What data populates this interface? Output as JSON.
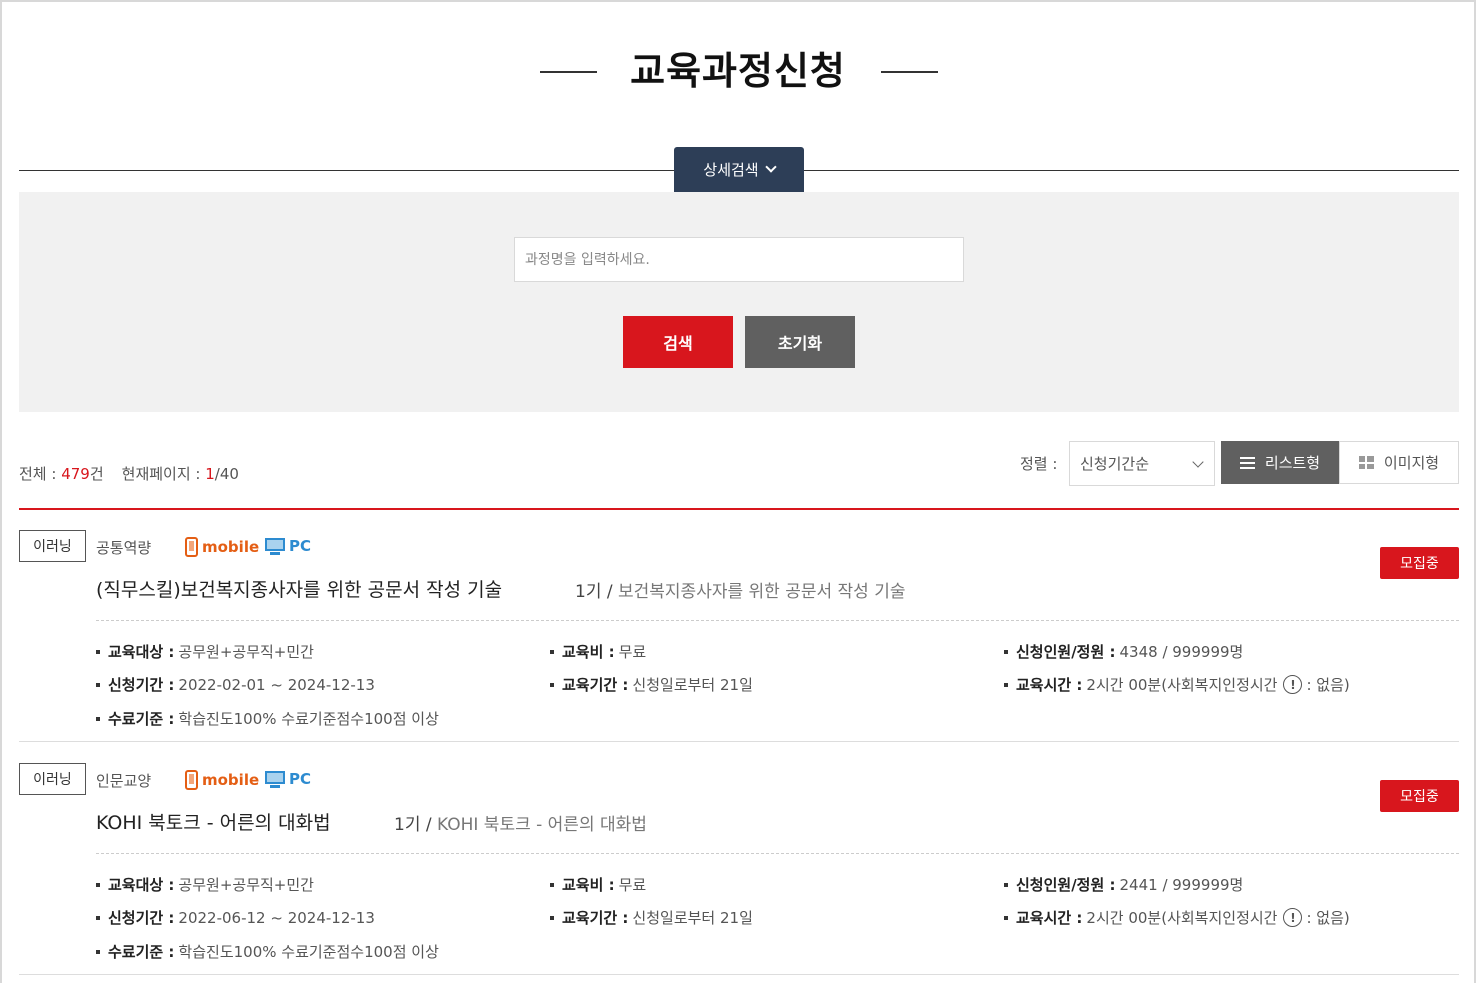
{
  "header": {
    "title": "교육과정신청"
  },
  "search": {
    "detail_label": "상세검색",
    "placeholder": "과정명을 입력하세요.",
    "search_label": "검색",
    "reset_label": "초기화"
  },
  "summary": {
    "total_label": "전체 : ",
    "total_count": "479",
    "total_unit": "건",
    "page_label": "현재페이지 : ",
    "current_page": "1",
    "total_pages": "/40"
  },
  "sort": {
    "label": "정렬 :",
    "selected": "신청기간순",
    "view_list": "리스트형",
    "view_image": "이미지형"
  },
  "courses": [
    {
      "type": "이러닝",
      "category": "공통역량",
      "device_mobile": "mobile",
      "device_pc": "PC",
      "status": "모집중",
      "title": "(직무스킬)보건복지종사자를 위한 공문서 작성 기술",
      "cycle": "1기 / ",
      "cycle_sub": "보건복지종사자를 위한 공문서 작성 기술",
      "target_k": "교육대상 :",
      "target_v": "공무원+공무직+민간",
      "fee_k": "교육비 :",
      "fee_v": "무료",
      "applicants_k": "신청인원/정원 :",
      "applicants_v": "4348 / 999999명",
      "apply_period_k": "신청기간 :",
      "apply_period_v": "2022-02-01 ~ 2024-12-13",
      "edu_period_k": "교육기간 :",
      "edu_period_v": "신청일로부터 21일",
      "edu_time_k": "교육시간 :",
      "edu_time_v": "2시간 00분(사회복지인정시간",
      "edu_time_v2": ": 없음)",
      "complete_k": "수료기준 :",
      "complete_v": "학습진도100% 수료기준점수100점 이상"
    },
    {
      "type": "이러닝",
      "category": "인문교양",
      "device_mobile": "mobile",
      "device_pc": "PC",
      "status": "모집중",
      "title": "KOHI 북토크 - 어른의 대화법",
      "cycle": "1기 / ",
      "cycle_sub": "KOHI 북토크 - 어른의 대화법",
      "target_k": "교육대상 :",
      "target_v": "공무원+공무직+민간",
      "fee_k": "교육비 :",
      "fee_v": "무료",
      "applicants_k": "신청인원/정원 :",
      "applicants_v": "2441 / 999999명",
      "apply_period_k": "신청기간 :",
      "apply_period_v": "2022-06-12 ~ 2024-12-13",
      "edu_period_k": "교육기간 :",
      "edu_period_v": "신청일로부터 21일",
      "edu_time_k": "교육시간 :",
      "edu_time_v": "2시간 00분(사회복지인정시간",
      "edu_time_v2": ": 없음)",
      "complete_k": "수료기준 :",
      "complete_v": "학습진도100% 수료기준점수100점 이상"
    }
  ],
  "icons": {
    "detail": "chevron-down-icon",
    "mobile": "mobile-phone-icon",
    "pc": "monitor-icon",
    "list": "list-icon",
    "grid": "grid-icon",
    "info": "info-circle-icon"
  },
  "colors": {
    "accent": "#d8161d",
    "navy": "#2d3e57",
    "gray_button": "#606060"
  }
}
